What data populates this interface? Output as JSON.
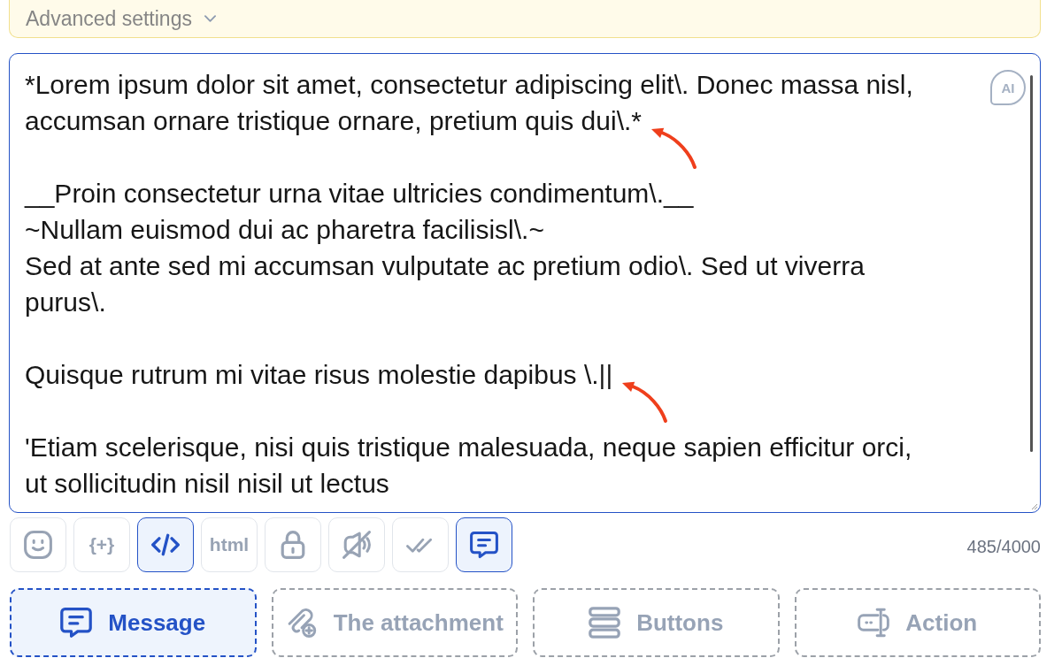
{
  "advanced_settings": {
    "label": "Advanced settings",
    "expanded": false
  },
  "editor": {
    "blocks": [
      {
        "lines": [
          {
            "text": "*Lorem ipsum dolor sit amet, consectetur adipiscing elit\\. Donec massa nisl,",
            "annotated": false
          },
          {
            "text": "accumsan ornare tristique ornare, pretium quis dui\\.*",
            "annotated": true
          }
        ]
      },
      {
        "lines": [
          {
            "text": "__Proin consectetur urna vitae ultricies condimentum\\.__",
            "annotated": false
          },
          {
            "text": "~Nullam euismod dui ac pharetra facilisisl\\.~",
            "annotated": false
          },
          {
            "text": "Sed at ante sed mi accumsan vulputate ac pretium odio\\. Sed ut viverra",
            "annotated": false
          },
          {
            "text": "purus\\.",
            "annotated": false
          }
        ]
      },
      {
        "lines": [
          {
            "text": "Quisque rutrum mi vitae risus molestie dapibus \\.||",
            "annotated": true
          }
        ]
      },
      {
        "lines": [
          {
            "text": "'Etiam scelerisque, nisi quis tristique malesuada, neque sapien efficitur orci,",
            "annotated": false
          },
          {
            "text": "ut sollicitudin nisil nisil ut lectus",
            "annotated": false
          }
        ]
      }
    ],
    "ai_button": "AI"
  },
  "toolbar": {
    "buttons": [
      {
        "kind": "emoji",
        "selected": false
      },
      {
        "kind": "variable",
        "label": "{+}",
        "selected": false
      },
      {
        "kind": "code",
        "selected": true
      },
      {
        "kind": "html",
        "label": "html",
        "selected": false
      },
      {
        "kind": "lock",
        "selected": false
      },
      {
        "kind": "mute",
        "selected": false
      },
      {
        "kind": "read",
        "selected": false
      },
      {
        "kind": "message",
        "selected": true
      }
    ],
    "counter": "485/4000"
  },
  "message_types": [
    {
      "kind": "message",
      "label": "Message",
      "selected": true
    },
    {
      "kind": "attachment",
      "label": "The attachment",
      "selected": false
    },
    {
      "kind": "buttons",
      "label": "Buttons",
      "selected": false
    },
    {
      "kind": "action",
      "label": "Action",
      "selected": false
    }
  ]
}
